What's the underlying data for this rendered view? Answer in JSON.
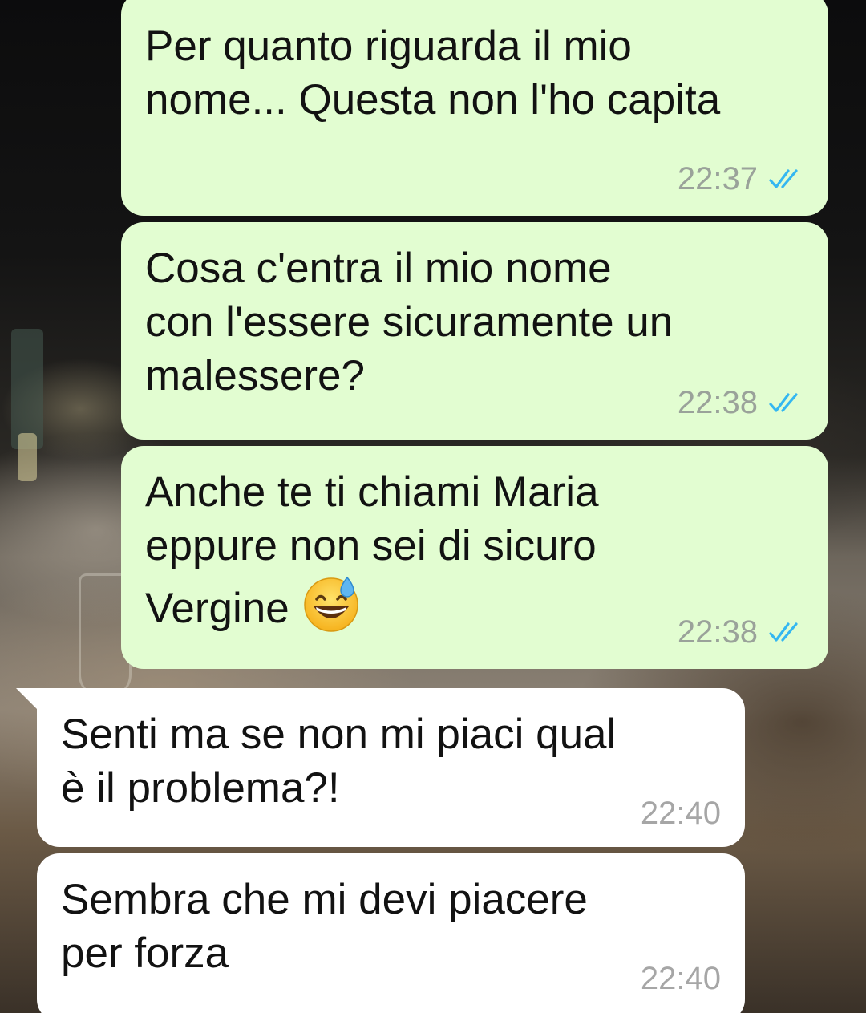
{
  "messages": [
    {
      "direction": "outgoing",
      "text": "Per quanto riguarda il mio\nnome... Questa non l'ho capita",
      "time": "22:37",
      "status": "read",
      "status_icon": "double-check-icon",
      "status_color": "#34b7f1"
    },
    {
      "direction": "outgoing",
      "text": "Cosa c'entra il mio nome\ncon l'essere sicuramente un\nmalessere?",
      "time": "22:38",
      "status": "read",
      "status_icon": "double-check-icon",
      "status_color": "#34b7f1"
    },
    {
      "direction": "outgoing",
      "text": "Anche te ti chiami Maria\neppure non sei di sicuro\nVergine",
      "emoji": "grinning-face-with-sweat-icon",
      "time": "22:38",
      "status": "read",
      "status_icon": "double-check-icon",
      "status_color": "#34b7f1"
    },
    {
      "direction": "incoming",
      "text": "Senti ma se non mi piaci qual\nè il problema?!",
      "time": "22:40"
    },
    {
      "direction": "incoming",
      "text": "Sembra che mi devi piacere\nper forza",
      "time": "22:40"
    }
  ],
  "colors": {
    "outgoing_bubble": "#e2fdd1",
    "incoming_bubble": "#ffffff",
    "read_ticks": "#34b7f1"
  }
}
